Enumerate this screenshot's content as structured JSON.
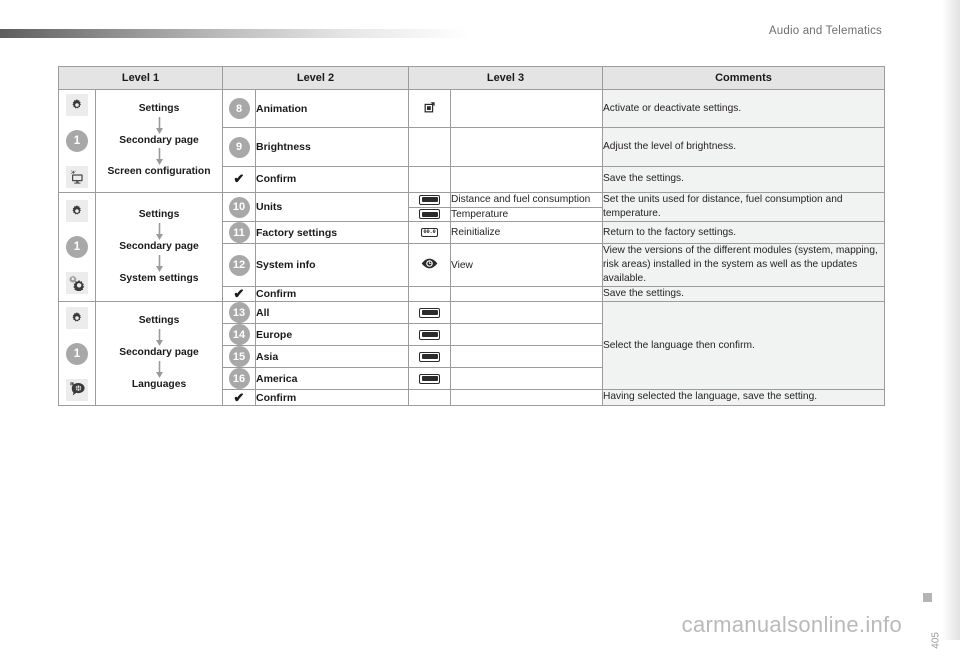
{
  "header": {
    "title": "Audio and Telematics"
  },
  "table": {
    "columns": [
      "Level 1",
      "Level 2",
      "Level 3",
      "Comments"
    ],
    "groups": [
      {
        "icons": [
          "gear-icon",
          "badge-1",
          "screen-configuration-icon"
        ],
        "badge": "1",
        "path": [
          "Settings",
          "Secondary page",
          "Screen configuration"
        ],
        "rows": [
          {
            "num": "8",
            "level2": "Animation",
            "level3_icon": "toggle-square-icon",
            "level3": "",
            "comment": "Activate or deactivate settings."
          },
          {
            "num": "9",
            "level2": "Brightness",
            "level3_icon": "",
            "level3": "",
            "comment": "Adjust the level of brightness."
          },
          {
            "num": "check",
            "level2": "Confirm",
            "level3_icon": "",
            "level3": "",
            "comment": "Save the settings."
          }
        ]
      },
      {
        "icons": [
          "gear-icon",
          "badge-1",
          "system-settings-icon"
        ],
        "badge": "1",
        "path": [
          "Settings",
          "Secondary page",
          "System settings"
        ],
        "rows": [
          {
            "num": "10",
            "level2": "Units",
            "sub": [
              {
                "icon": "bar-toggle-icon",
                "label": "Distance and fuel consumption"
              },
              {
                "icon": "bar-toggle-icon",
                "label": "Temperature"
              }
            ],
            "comment": "Set the units used for distance, fuel consumption and temperature."
          },
          {
            "num": "11",
            "level2": "Factory settings",
            "level3_icon": "digit-display-icon",
            "level3_icon_text": "00.0",
            "level3": "Reinitialize",
            "comment": "Return to the factory settings."
          },
          {
            "num": "12",
            "level2": "System info",
            "level3_icon": "eye-icon",
            "level3": "View",
            "comment": "View the versions of the different modules (system, mapping, risk areas) installed in the system as well as the updates available."
          },
          {
            "num": "check",
            "level2": "Confirm",
            "level3_icon": "",
            "level3": "",
            "comment": "Save the settings."
          }
        ]
      },
      {
        "icons": [
          "gear-icon",
          "badge-1",
          "languages-icon"
        ],
        "badge": "1",
        "path": [
          "Settings",
          "Secondary page",
          "Languages"
        ],
        "rows": [
          {
            "num": "13",
            "level2": "All",
            "level3_icon": "bar-toggle-icon",
            "level3": ""
          },
          {
            "num": "14",
            "level2": "Europe",
            "level3_icon": "bar-toggle-icon",
            "level3": ""
          },
          {
            "num": "15",
            "level2": "Asia",
            "level3_icon": "bar-toggle-icon",
            "level3": ""
          },
          {
            "num": "16",
            "level2": "America",
            "level3_icon": "bar-toggle-icon",
            "level3": ""
          },
          {
            "num": "check",
            "level2": "Confirm",
            "level3_icon": "",
            "level3": ""
          }
        ],
        "merged_comment": "Select the language then confirm.",
        "last_comment": "Having selected the language, save the setting."
      }
    ]
  },
  "footer": {
    "watermark": "carmanualsonline.info",
    "page_number": "405"
  },
  "colors": {
    "header_fill": "#e4e4e4",
    "comment_fill": "#f1f3f3",
    "badge_fill": "#a8a8a8",
    "border": "#9c9c9c",
    "text": "#231f20"
  }
}
